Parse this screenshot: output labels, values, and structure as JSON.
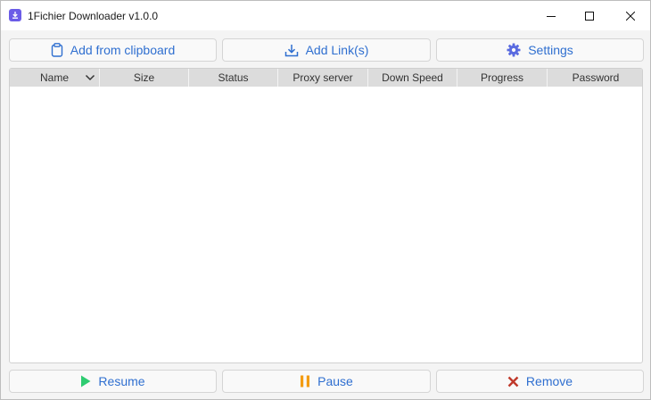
{
  "window": {
    "title": "1Fichier Downloader v1.0.0",
    "icon": "download-icon",
    "accent": "#6b5ce7"
  },
  "toolbar": {
    "clipboard_label": "Add from clipboard",
    "add_links_label": "Add Link(s)",
    "settings_label": "Settings"
  },
  "table": {
    "columns": [
      "Name",
      "Size",
      "Status",
      "Proxy server",
      "Down Speed",
      "Progress",
      "Password"
    ],
    "sort_column": "Name",
    "rows": []
  },
  "actions": {
    "resume_label": "Resume",
    "pause_label": "Pause",
    "remove_label": "Remove"
  },
  "colors": {
    "link_text": "#2f6fd0",
    "resume_icon": "#2ecc71",
    "pause_icon": "#f39c12",
    "remove_icon": "#c0392b",
    "header_bg": "#dcdcdc"
  }
}
